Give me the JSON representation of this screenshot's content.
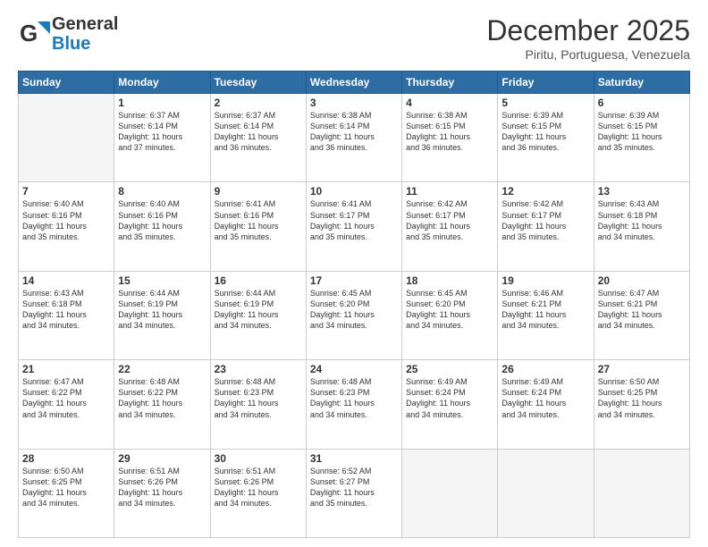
{
  "header": {
    "logo_general": "General",
    "logo_blue": "Blue",
    "month_title": "December 2025",
    "location": "Piritu, Portuguesa, Venezuela"
  },
  "days_of_week": [
    "Sunday",
    "Monday",
    "Tuesday",
    "Wednesday",
    "Thursday",
    "Friday",
    "Saturday"
  ],
  "weeks": [
    [
      {
        "day": "",
        "info": ""
      },
      {
        "day": "1",
        "info": "Sunrise: 6:37 AM\nSunset: 6:14 PM\nDaylight: 11 hours\nand 37 minutes."
      },
      {
        "day": "2",
        "info": "Sunrise: 6:37 AM\nSunset: 6:14 PM\nDaylight: 11 hours\nand 36 minutes."
      },
      {
        "day": "3",
        "info": "Sunrise: 6:38 AM\nSunset: 6:14 PM\nDaylight: 11 hours\nand 36 minutes."
      },
      {
        "day": "4",
        "info": "Sunrise: 6:38 AM\nSunset: 6:15 PM\nDaylight: 11 hours\nand 36 minutes."
      },
      {
        "day": "5",
        "info": "Sunrise: 6:39 AM\nSunset: 6:15 PM\nDaylight: 11 hours\nand 36 minutes."
      },
      {
        "day": "6",
        "info": "Sunrise: 6:39 AM\nSunset: 6:15 PM\nDaylight: 11 hours\nand 35 minutes."
      }
    ],
    [
      {
        "day": "7",
        "info": "Sunrise: 6:40 AM\nSunset: 6:16 PM\nDaylight: 11 hours\nand 35 minutes."
      },
      {
        "day": "8",
        "info": "Sunrise: 6:40 AM\nSunset: 6:16 PM\nDaylight: 11 hours\nand 35 minutes."
      },
      {
        "day": "9",
        "info": "Sunrise: 6:41 AM\nSunset: 6:16 PM\nDaylight: 11 hours\nand 35 minutes."
      },
      {
        "day": "10",
        "info": "Sunrise: 6:41 AM\nSunset: 6:17 PM\nDaylight: 11 hours\nand 35 minutes."
      },
      {
        "day": "11",
        "info": "Sunrise: 6:42 AM\nSunset: 6:17 PM\nDaylight: 11 hours\nand 35 minutes."
      },
      {
        "day": "12",
        "info": "Sunrise: 6:42 AM\nSunset: 6:17 PM\nDaylight: 11 hours\nand 35 minutes."
      },
      {
        "day": "13",
        "info": "Sunrise: 6:43 AM\nSunset: 6:18 PM\nDaylight: 11 hours\nand 34 minutes."
      }
    ],
    [
      {
        "day": "14",
        "info": "Sunrise: 6:43 AM\nSunset: 6:18 PM\nDaylight: 11 hours\nand 34 minutes."
      },
      {
        "day": "15",
        "info": "Sunrise: 6:44 AM\nSunset: 6:19 PM\nDaylight: 11 hours\nand 34 minutes."
      },
      {
        "day": "16",
        "info": "Sunrise: 6:44 AM\nSunset: 6:19 PM\nDaylight: 11 hours\nand 34 minutes."
      },
      {
        "day": "17",
        "info": "Sunrise: 6:45 AM\nSunset: 6:20 PM\nDaylight: 11 hours\nand 34 minutes."
      },
      {
        "day": "18",
        "info": "Sunrise: 6:45 AM\nSunset: 6:20 PM\nDaylight: 11 hours\nand 34 minutes."
      },
      {
        "day": "19",
        "info": "Sunrise: 6:46 AM\nSunset: 6:21 PM\nDaylight: 11 hours\nand 34 minutes."
      },
      {
        "day": "20",
        "info": "Sunrise: 6:47 AM\nSunset: 6:21 PM\nDaylight: 11 hours\nand 34 minutes."
      }
    ],
    [
      {
        "day": "21",
        "info": "Sunrise: 6:47 AM\nSunset: 6:22 PM\nDaylight: 11 hours\nand 34 minutes."
      },
      {
        "day": "22",
        "info": "Sunrise: 6:48 AM\nSunset: 6:22 PM\nDaylight: 11 hours\nand 34 minutes."
      },
      {
        "day": "23",
        "info": "Sunrise: 6:48 AM\nSunset: 6:23 PM\nDaylight: 11 hours\nand 34 minutes."
      },
      {
        "day": "24",
        "info": "Sunrise: 6:48 AM\nSunset: 6:23 PM\nDaylight: 11 hours\nand 34 minutes."
      },
      {
        "day": "25",
        "info": "Sunrise: 6:49 AM\nSunset: 6:24 PM\nDaylight: 11 hours\nand 34 minutes."
      },
      {
        "day": "26",
        "info": "Sunrise: 6:49 AM\nSunset: 6:24 PM\nDaylight: 11 hours\nand 34 minutes."
      },
      {
        "day": "27",
        "info": "Sunrise: 6:50 AM\nSunset: 6:25 PM\nDaylight: 11 hours\nand 34 minutes."
      }
    ],
    [
      {
        "day": "28",
        "info": "Sunrise: 6:50 AM\nSunset: 6:25 PM\nDaylight: 11 hours\nand 34 minutes."
      },
      {
        "day": "29",
        "info": "Sunrise: 6:51 AM\nSunset: 6:26 PM\nDaylight: 11 hours\nand 34 minutes."
      },
      {
        "day": "30",
        "info": "Sunrise: 6:51 AM\nSunset: 6:26 PM\nDaylight: 11 hours\nand 34 minutes."
      },
      {
        "day": "31",
        "info": "Sunrise: 6:52 AM\nSunset: 6:27 PM\nDaylight: 11 hours\nand 35 minutes."
      },
      {
        "day": "",
        "info": ""
      },
      {
        "day": "",
        "info": ""
      },
      {
        "day": "",
        "info": ""
      }
    ]
  ]
}
